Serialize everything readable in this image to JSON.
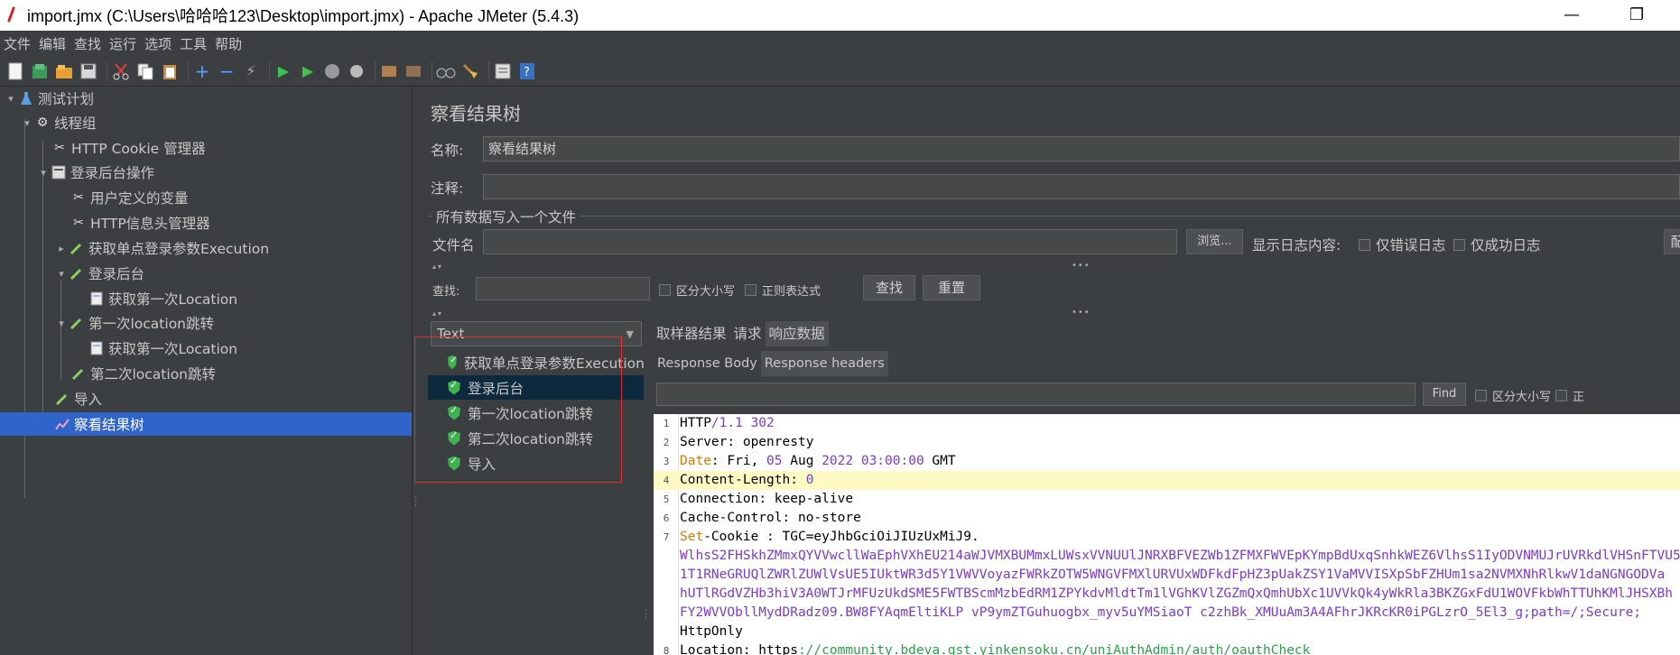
{
  "window": {
    "title": "import.jmx (C:\\Users\\哈哈哈123\\Desktop\\import.jmx) - Apache JMeter (5.4.3)",
    "minimize": "—",
    "restore": "❐"
  },
  "menu": [
    "文件",
    "编辑",
    "查找",
    "运行",
    "选项",
    "工具",
    "帮助"
  ],
  "tree": {
    "items": [
      {
        "label": "测试计划",
        "icon": "flask-icon"
      },
      {
        "label": "线程组",
        "icon": "gear-icon"
      },
      {
        "label": "HTTP Cookie 管理器",
        "icon": "wrench-icon"
      },
      {
        "label": "登录后台操作",
        "icon": "controller-icon"
      },
      {
        "label": "用户定义的变量",
        "icon": "wrench-icon"
      },
      {
        "label": "HTTP信息头管理器",
        "icon": "wrench-icon"
      },
      {
        "label": "获取单点登录参数Execution",
        "icon": "pipette-icon"
      },
      {
        "label": "登录后台",
        "icon": "pipette-icon"
      },
      {
        "label": "获取第一次Location",
        "icon": "document-icon"
      },
      {
        "label": "第一次location跳转",
        "icon": "pipette-icon"
      },
      {
        "label": "获取第一次Location",
        "icon": "document-icon"
      },
      {
        "label": "第二次location跳转",
        "icon": "pipette-icon"
      },
      {
        "label": "导入",
        "icon": "pipette-icon"
      },
      {
        "label": "察看结果树",
        "icon": "chart-icon"
      }
    ]
  },
  "panel": {
    "title": "察看结果树",
    "name_label": "名称:",
    "name_value": "察看结果树",
    "comment_label": "注释:",
    "file_group_label": "所有数据写入一个文件",
    "filename_label": "文件名",
    "browse_button": "浏览...",
    "log_content_label": "显示日志内容:",
    "errors_only_label": "仅错误日志",
    "success_only_label": "仅成功日志",
    "cut_button": "配",
    "search_label": "查找:",
    "case_sensitive_label": "区分大小写",
    "regex_label": "正则表达式",
    "search_button": "查找",
    "reset_button": "重置"
  },
  "results": {
    "renderer": "Text",
    "samples": [
      {
        "label": "获取单点登录参数Execution"
      },
      {
        "label": "登录后台"
      },
      {
        "label": "第一次location跳转"
      },
      {
        "label": "第二次location跳转"
      },
      {
        "label": "导入"
      }
    ],
    "tabs": [
      "取样器结果",
      "请求",
      "响应数据"
    ],
    "subtabs": [
      "Response Body",
      "Response headers"
    ],
    "find_button": "Find",
    "find_case_label": "区分大小写",
    "find_regex_label": "正"
  },
  "response_lines": {
    "l1": {
      "num": "1",
      "a": "HTTP",
      "b": "/1.1 302"
    },
    "l2": {
      "num": "2",
      "a": "Server",
      "b": ": openresty"
    },
    "l3": {
      "num": "3",
      "a": "Date",
      "b": ": Fri,",
      "c": "05",
      "d": "Aug",
      "e": "2022 03:00:00",
      "f": "GMT"
    },
    "l4": {
      "num": "4",
      "a": "Content-Length:",
      "b": "0"
    },
    "l5": {
      "num": "5",
      "a": "Connection",
      "b": ": keep-alive"
    },
    "l6": {
      "num": "6",
      "a": "Cache-Control",
      "b": ": no-store"
    },
    "l7": {
      "num": "7",
      "a": "Set",
      "b": "-Cookie : TGC=eyJhbGciOiJIUzUxMiJ9."
    },
    "l7b": "WlhsS2FHSkhZMmxQYVVwcllWaEphVXhEU214aWJVMXBUMmxLUWsxVVNUUlJNRXBFVEZWb1ZFMXFWVEpKYmpBdUxqSnhkWEZ6VlhsS1IyODVNMUJrUVRkdlVHSnFTVU5",
    "l7c": "1T1RNeGRUQlZWRlZUWlVsUE5IUktWR3d5Y1VWVVoyazFWRkZOTW5WNGVFMXlURVUxWDFkdFpHZ3pUakZSY1VaMVVISXpSbFZHUm1sa2NVMXNhRlkwV1daNGNGODVa",
    "l7d": "hUTlRGdVZHb3hiV3A0WTJrMFUzUkdSME5FWTBScmMzbEdRM1ZPYkdvMldtTm1lVGhKVlZGZmQxQmhUbXc1UVVkQk4yWkRla3BKZGxFdU1WOVFkbWhTTUhKMlJHSXBh",
    "l7e": "FY2WVVObllMydDRadz09.BW8FYAqmEltiKLP vP9ymZTGuhuogbx_myv5uYMSiaoT c2zhBk_XMUuAm3A4AFhrJKRcKR0iPGLzrO_5El3_g;path=/;Secure;",
    "l7f": "HttpOnly",
    "l8": {
      "num": "8",
      "a": "Location",
      "b": ": https",
      "c": "://community.bdeva.gst.yinkensoku.cn/uniAuthAdmin/auth/oauthCheck"
    }
  }
}
